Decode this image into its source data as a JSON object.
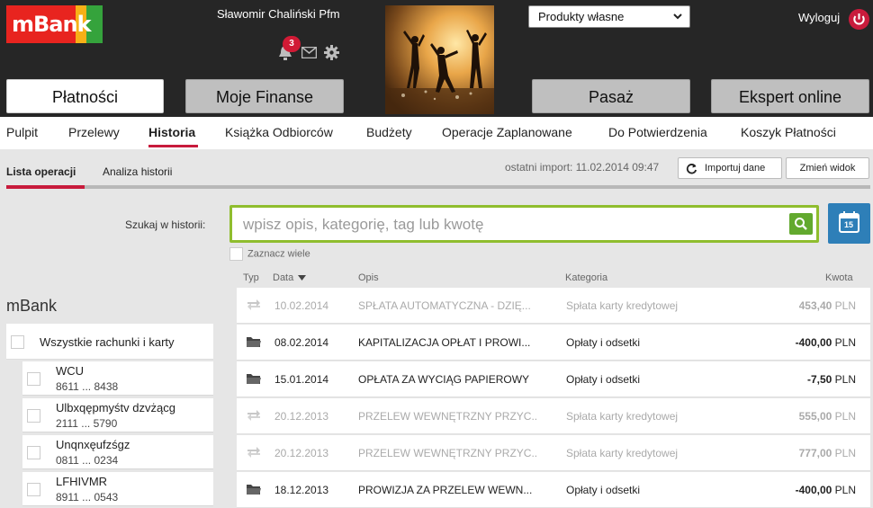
{
  "header": {
    "logo_text": "mBank",
    "username": "Sławomir Chaliński Pfm",
    "notification_count": "3",
    "product_select": "Produkty własne",
    "logout": "Wyloguj"
  },
  "top_buttons": [
    {
      "label": "Płatności",
      "active": true
    },
    {
      "label": "Moje Finanse",
      "active": false
    },
    {
      "label": "Pasaż",
      "active": false
    },
    {
      "label": "Ekspert online",
      "active": false
    }
  ],
  "nav": [
    "Pulpit",
    "Przelewy",
    "Historia",
    "Książka Odbiorców",
    "Budżety",
    "Operacje Zaplanowane",
    "Do Potwierdzenia",
    "Koszyk Płatności"
  ],
  "nav_active": "Historia",
  "subtabs": [
    "Lista operacji",
    "Analiza historii"
  ],
  "import_text": "ostatni import: 11.02.2014 09:47",
  "import_button": "Importuj dane",
  "change_view_button": "Zmień widok",
  "search": {
    "label": "Szukaj w historii:",
    "placeholder": "wpisz opis, kategorię, tag lub kwotę",
    "select_many": "Zaznacz wiele",
    "calendar_day": "15"
  },
  "table_headers": {
    "type": "Typ",
    "date": "Data",
    "desc": "Opis",
    "category": "Kategoria",
    "amount": "Kwota"
  },
  "accounts": {
    "title": "mBank",
    "all_label": "Wszystkie rachunki i karty",
    "items": [
      {
        "name": "WCU",
        "number": "8611 ... 8438"
      },
      {
        "name": "Ulbxqępmyśtv dzvżącg",
        "number": "2111 ... 5790"
      },
      {
        "name": "Unqnxęufzśgz",
        "number": "0811 ... 0234"
      },
      {
        "name": "LFHIVMR",
        "number": "8911 ... 0543"
      }
    ]
  },
  "operations": [
    {
      "type": "transfer",
      "date": "10.02.2014",
      "desc": "SPŁATA AUTOMATYCZNA - DZIĘ...",
      "category": "Spłata karty kredytowej",
      "amount": "453,40",
      "currency": "PLN",
      "dim": true
    },
    {
      "type": "folder",
      "date": "08.02.2014",
      "desc": "KAPITALIZACJA OPŁAT I PROWI...",
      "category": "Opłaty i odsetki",
      "amount": "-400,00",
      "currency": "PLN",
      "dim": false
    },
    {
      "type": "folder",
      "date": "15.01.2014",
      "desc": "OPŁATA ZA WYCIĄG PAPIEROWY",
      "category": "Opłaty i odsetki",
      "amount": "-7,50",
      "currency": "PLN",
      "dim": false
    },
    {
      "type": "transfer",
      "date": "20.12.2013",
      "desc": "PRZELEW WEWNĘTRZNY PRZYC...",
      "category": "Spłata karty kredytowej",
      "amount": "555,00",
      "currency": "PLN",
      "dim": true
    },
    {
      "type": "transfer",
      "date": "20.12.2013",
      "desc": "PRZELEW WEWNĘTRZNY PRZYC...",
      "category": "Spłata karty kredytowej",
      "amount": "777,00",
      "currency": "PLN",
      "dim": true
    },
    {
      "type": "folder",
      "date": "18.12.2013",
      "desc": "PROWIZJA ZA PRZELEW WEWN...",
      "category": "Opłaty i odsetki",
      "amount": "-400,00",
      "currency": "PLN",
      "dim": false
    }
  ],
  "colors": {
    "accent": "#c81b3c",
    "search_border": "#8fbd2e",
    "calendar": "#2e7fb8"
  }
}
